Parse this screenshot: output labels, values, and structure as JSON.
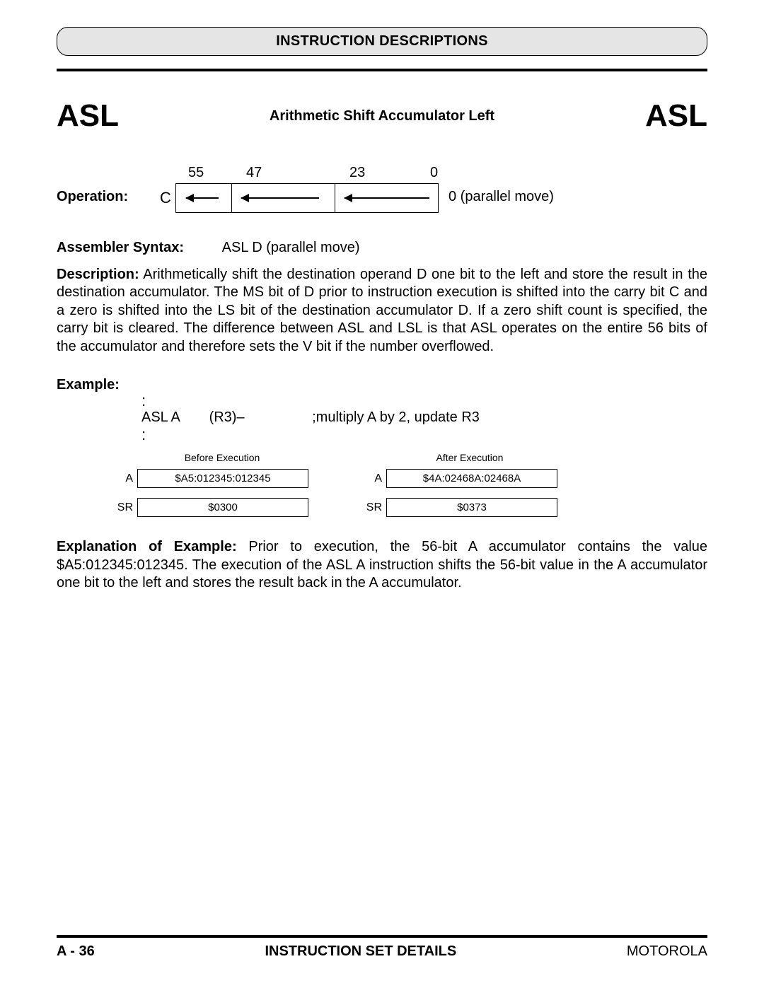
{
  "header": {
    "title": "INSTRUCTION DESCRIPTIONS"
  },
  "title": {
    "mnemonic_left": "ASL",
    "description": "Arithmetic Shift Accumulator Left",
    "mnemonic_right": "ASL"
  },
  "operation": {
    "label": "Operation:",
    "c_label": "C",
    "bit_55": "55",
    "bit_47": "47",
    "bit_23": "23",
    "bit_0": "0",
    "right_text": "0 (parallel move)"
  },
  "assembler": {
    "label": "Assembler Syntax:",
    "value": "ASL D (parallel move)"
  },
  "description": {
    "label": "Description:",
    "text": " Arithmetically shift the destination operand D one bit to the left and store the result in the destination accumulator. The MS bit of D prior to instruction execution is shifted into the carry bit C and a zero is shifted into the LS bit of the destination accumulator D. If a zero shift count is specified, the carry bit is cleared. The difference between ASL and LSL is that ASL operates on the entire 56 bits of the accumulator and therefore sets the V bit if the number overflowed."
  },
  "example": {
    "label": "Example:",
    "code_col1": "ASL A",
    "code_col2": "(R3)–",
    "comment": ";multiply A by 2, update R3",
    "before_label": "Before Execution",
    "after_label": "After Execution",
    "reg_a": "A",
    "reg_sr": "SR",
    "before_a": "$A5:012345:012345",
    "after_a": "$4A:02468A:02468A",
    "before_sr": "$0300",
    "after_sr": "$0373"
  },
  "explanation": {
    "label": "Explanation of Example:",
    "text": " Prior to execution, the 56-bit A accumulator contains the value $A5:012345:012345. The execution of the ASL A instruction shifts the 56-bit value in the A accumulator one bit to the left and stores the result back in the A accumulator."
  },
  "footer": {
    "page": "A - 36",
    "section": "INSTRUCTION SET DETAILS",
    "vendor": "MOTOROLA"
  }
}
